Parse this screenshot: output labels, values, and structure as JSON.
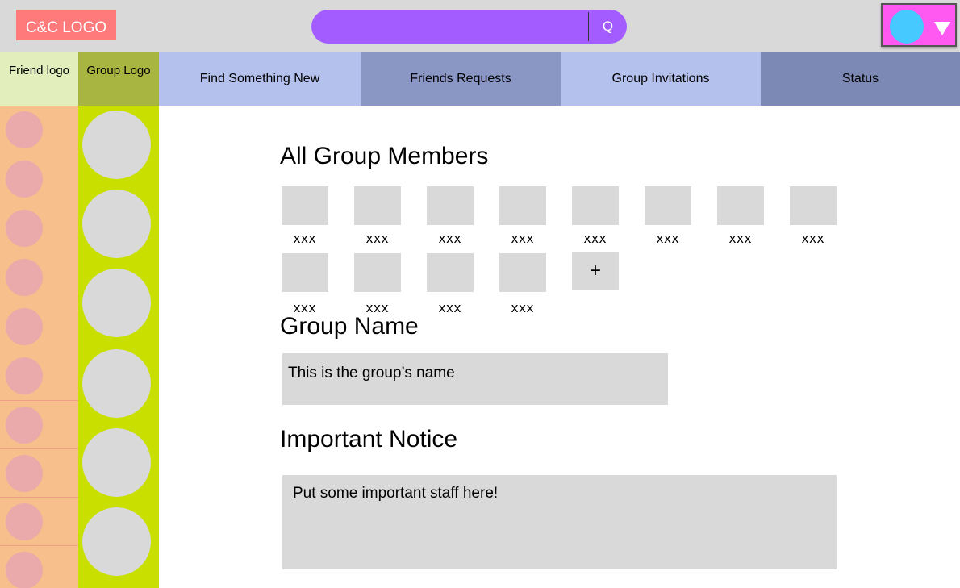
{
  "header": {
    "logo_text": "C&C LOGO",
    "search_placeholder": "",
    "search_button": "Q"
  },
  "sidebar_headers": {
    "friend": "Friend logo",
    "group": "Group Logo"
  },
  "tabs": [
    {
      "label": "Find Something New",
      "color": "#b4c1ec"
    },
    {
      "label": "Friends Requests",
      "color": "#8a97c4"
    },
    {
      "label": "Group Invitations",
      "color": "#b4c1ec"
    },
    {
      "label": "Status",
      "color": "#7c89b4"
    }
  ],
  "main": {
    "members_title": "All Group Members",
    "members": [
      "xxx",
      "xxx",
      "xxx",
      "xxx",
      "xxx",
      "xxx",
      "xxx",
      "xxx",
      "xxx",
      "xxx",
      "xxx",
      "xxx"
    ],
    "add_member": "+",
    "group_name_title": "Group Name",
    "group_name_value": "This is the group’s name",
    "notice_title": "Important Notice",
    "notice_value": "Put some important staff here!"
  },
  "colors": {
    "accent_search": "#a35cff",
    "logo": "#ff7b7b",
    "profile": "#ff59f1",
    "avatar": "#45c9ff",
    "friend_column": "#f6bf8b",
    "group_column": "#c8df00"
  }
}
